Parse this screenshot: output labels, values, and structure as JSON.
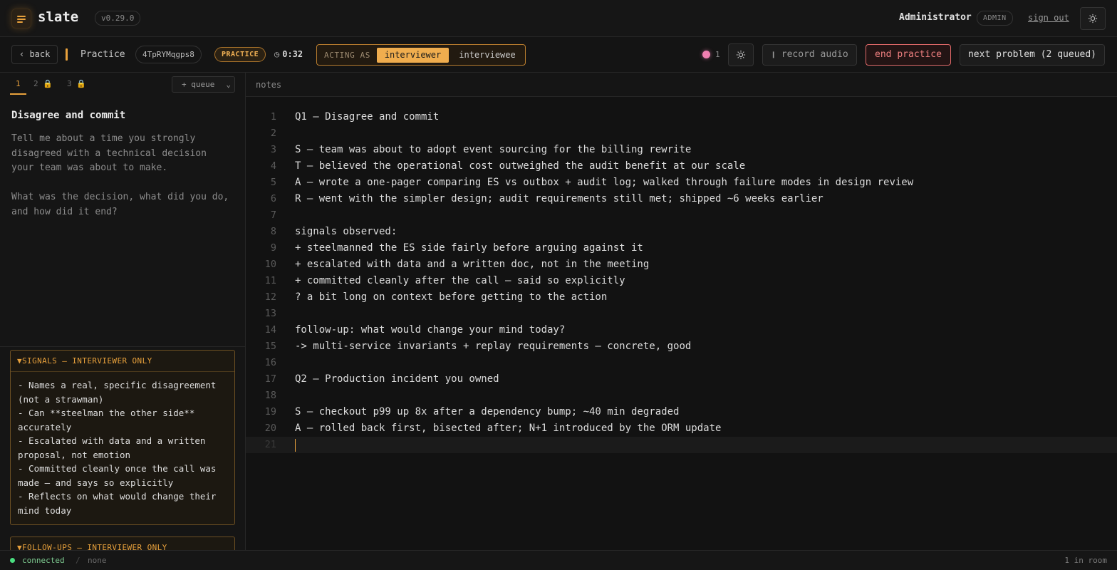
{
  "app": {
    "name": "slate",
    "version": "v0.29.0",
    "user": "Administrator",
    "role": "ADMIN",
    "sign_out": "sign out"
  },
  "toolbar": {
    "back": "‹ back",
    "mode": "Practice",
    "session_id": "4TpRYMqgps8",
    "badge": "PRACTICE",
    "timer": "0:32",
    "acting_label": "ACTING AS",
    "acting_options": [
      "interviewer",
      "interviewee"
    ],
    "acting_selected": "interviewer",
    "recording_count": "1",
    "record_audio": "record audio",
    "end_practice": "end practice",
    "next_problem": "next problem (2 queued)"
  },
  "question_tabs": [
    {
      "label": "1",
      "locked": false
    },
    {
      "label": "2 🔒",
      "locked": true
    },
    {
      "label": "3 🔒",
      "locked": true
    }
  ],
  "queue_select": "+ queue",
  "question": {
    "title": "Disagree and commit",
    "body": "Tell me about a time you strongly\ndisagreed with a technical decision\nyour team was about to make.\n\nWhat was the decision, what did you do,\nand how did it end?"
  },
  "signals": {
    "header": "▼SIGNALS — INTERVIEWER ONLY",
    "body": "- Names a real, specific disagreement\n(not a strawman)\n- Can **steelman the other side**\naccurately\n- Escalated with data and a written\nproposal, not emotion\n- Committed cleanly once the call was\nmade — and says so explicitly\n- Reflects on what would change their\nmind today"
  },
  "followups": {
    "header": "▼FOLLOW-UPS — INTERVIEWER ONLY"
  },
  "editor": {
    "tab": "notes",
    "lines": [
      "Q1 — Disagree and commit",
      "",
      "S — team was about to adopt event sourcing for the billing rewrite",
      "T — believed the operational cost outweighed the audit benefit at our scale",
      "A — wrote a one-pager comparing ES vs outbox + audit log; walked through failure modes in design review",
      "R — went with the simpler design; audit requirements still met; shipped ~6 weeks earlier",
      "",
      "signals observed:",
      "+ steelmanned the ES side fairly before arguing against it",
      "+ escalated with data and a written doc, not in the meeting",
      "+ committed cleanly after the call — said so explicitly",
      "? a bit long on context before getting to the action",
      "",
      "follow-up: what would change your mind today?",
      "-> multi-service invariants + replay requirements — concrete, good",
      "",
      "Q2 — Production incident you owned",
      "",
      "S — checkout p99 up 8x after a dependency bump; ~40 min degraded",
      "A — rolled back first, bisected after; N+1 introduced by the ORM update",
      ""
    ],
    "current_line": 21
  },
  "status": {
    "connection": "connected",
    "separator": "/",
    "extra": "none",
    "room": "1 in room"
  },
  "colors": {
    "accent": "#e8a13c",
    "danger": "#e26a6a",
    "recording": "#ef7fb0",
    "connected": "#4ade80"
  }
}
